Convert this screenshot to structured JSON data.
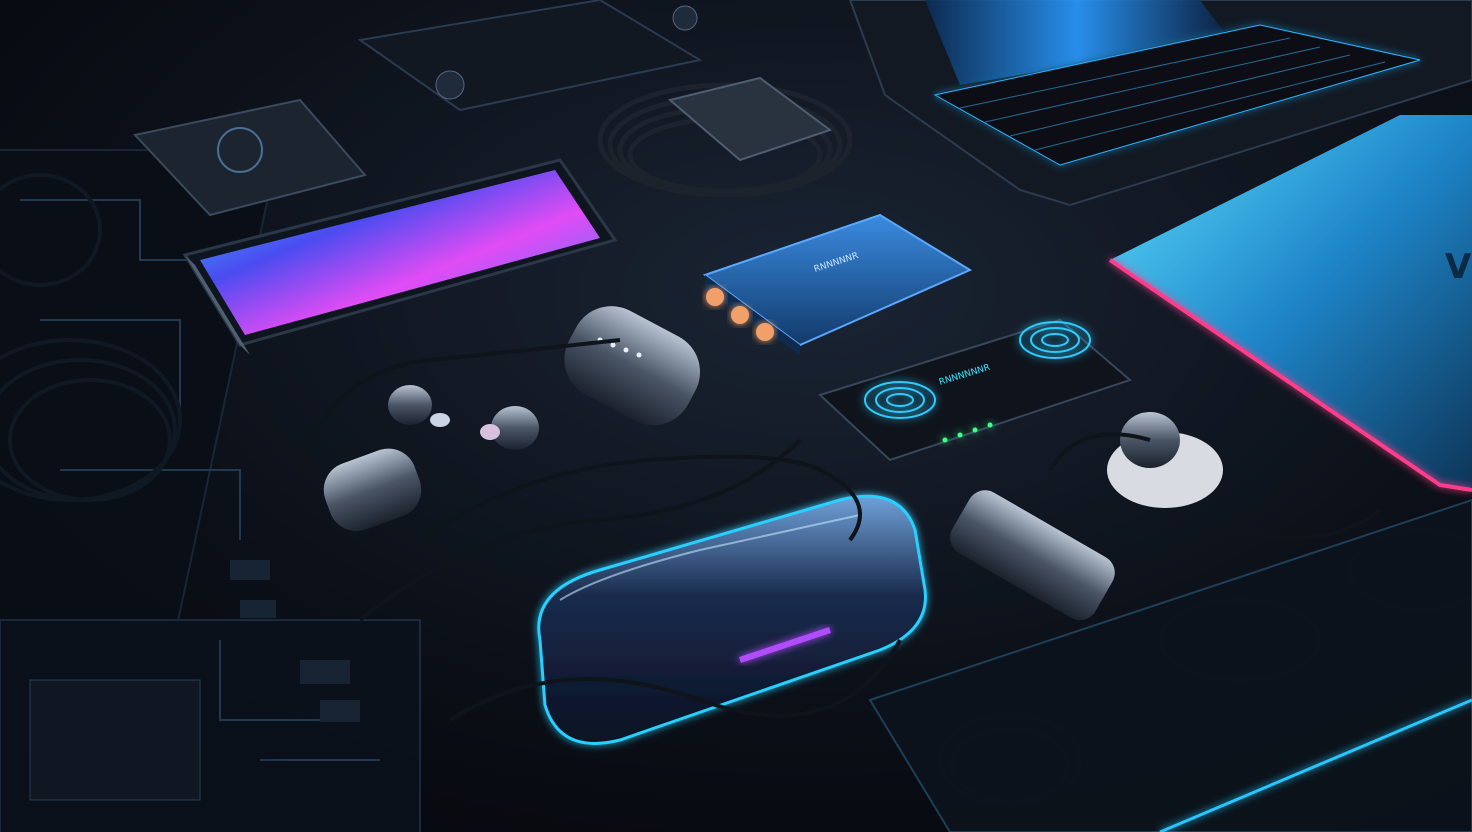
{
  "scene": {
    "subject": "",
    "colors": {
      "background": "#07090f",
      "desk": "#0d1118",
      "neon_cyan": "#27c7ff",
      "neon_pink": "#ff3d8b",
      "neon_purple": "#8a3dff",
      "device_blue": "#1f5f9e",
      "metal": "#5a6675"
    }
  },
  "labels": {
    "power_bank_blue": "RNNNNNR",
    "power_bank_black": "RNNNNNNR",
    "laptop_logo": "V"
  }
}
